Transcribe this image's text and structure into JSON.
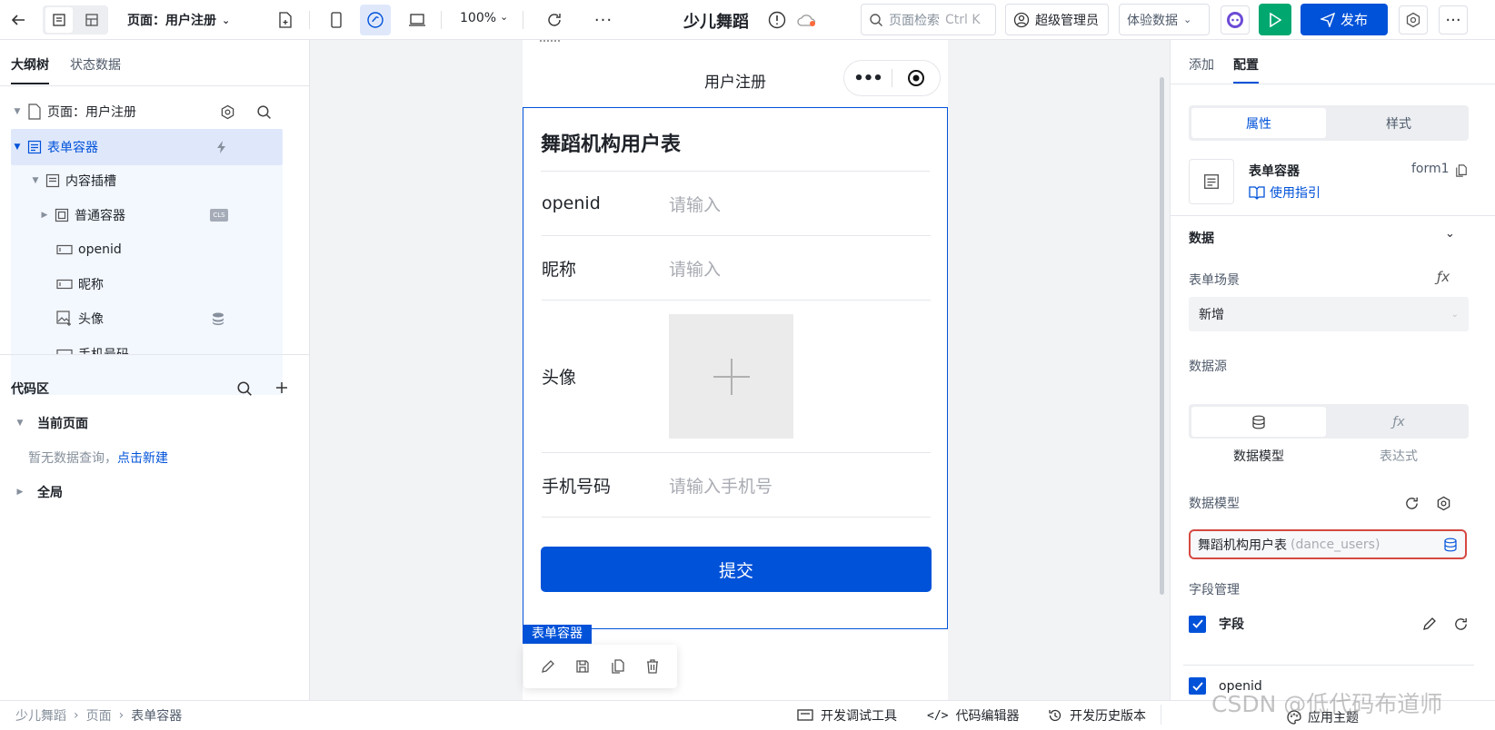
{
  "topbar": {
    "page_label": "页面：用户注册",
    "zoom": "100%",
    "app_title": "少儿舞蹈",
    "search_placeholder": "页面检索",
    "search_shortcut": "Ctrl K",
    "user": "超级管理员",
    "data_mode": "体验数据",
    "publish": "发布"
  },
  "left": {
    "tabs": [
      "大纲树",
      "状态数据"
    ],
    "tree": {
      "page": "页面：用户注册",
      "form": "表单容器",
      "slot": "内容插槽",
      "container": "普通容器",
      "container_badge": "CLS",
      "openid": "openid",
      "nickname": "昵称",
      "avatar": "头像",
      "phone": "手机号码"
    },
    "code": {
      "title": "代码区",
      "current_page": "当前页面",
      "empty_text": "暂无数据查询，",
      "empty_link": "点击新建",
      "global": "全局"
    }
  },
  "canvas": {
    "nav_title": "用户注册",
    "form_title": "舞蹈机构用户表",
    "fields": [
      {
        "label": "openid",
        "placeholder": "请输入"
      },
      {
        "label": "昵称",
        "placeholder": "请输入"
      },
      {
        "label": "头像",
        "placeholder": ""
      },
      {
        "label": "手机号码",
        "placeholder": "请输入手机号"
      }
    ],
    "submit": "提交",
    "selection_tag": "表单容器"
  },
  "right": {
    "tabs": [
      "添加",
      "配置"
    ],
    "segments": [
      "属性",
      "样式"
    ],
    "component_name": "表单容器",
    "component_id": "form1",
    "guide_link": "使用指引",
    "section_data": "数据",
    "form_scene_label": "表单场景",
    "form_scene_value": "新增",
    "datasource_label": "数据源",
    "ds_options": [
      "数据模型",
      "表达式"
    ],
    "data_model_label": "数据模型",
    "data_model_value": "舞蹈机构用户表",
    "data_model_key": "(dance_users)",
    "field_mgmt_label": "字段管理",
    "field_all": "字段",
    "field_first": "openid"
  },
  "bottom": {
    "breadcrumb": [
      "少儿舞蹈",
      "页面",
      "表单容器"
    ],
    "tools": [
      "开发调试工具",
      "代码编辑器",
      "开发历史版本",
      "应用主题"
    ]
  },
  "watermark": "CSDN @低代码布道师",
  "colors": {
    "accent": "#0052d9",
    "selected_bg": "#dfe8fb",
    "run_green": "#00a870",
    "highlight_red": "#d54941"
  }
}
